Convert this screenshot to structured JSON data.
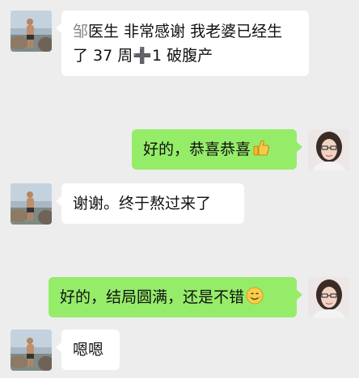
{
  "messages": [
    {
      "side": "in",
      "sender_name_char": "邹",
      "line1": "医生 非常感谢 我老婆已经生",
      "line2_before": "了 37 周",
      "line2_plus": "➕",
      "line2_after": "1  破腹产"
    },
    {
      "side": "out",
      "text": "好的，恭喜恭喜",
      "emoji_name": "thumbs-up-emoji"
    },
    {
      "side": "in",
      "text": "谢谢。终于熬过来了"
    },
    {
      "side": "out",
      "text": "好的，结局圆满，还是不错",
      "emoji_name": "smile-emoji"
    },
    {
      "side": "in",
      "text": "嗯嗯"
    }
  ],
  "colors": {
    "background": "#ededed",
    "incoming_bubble": "#ffffff",
    "outgoing_bubble": "#95ec69",
    "name_prefix": "#8a8a8a"
  }
}
